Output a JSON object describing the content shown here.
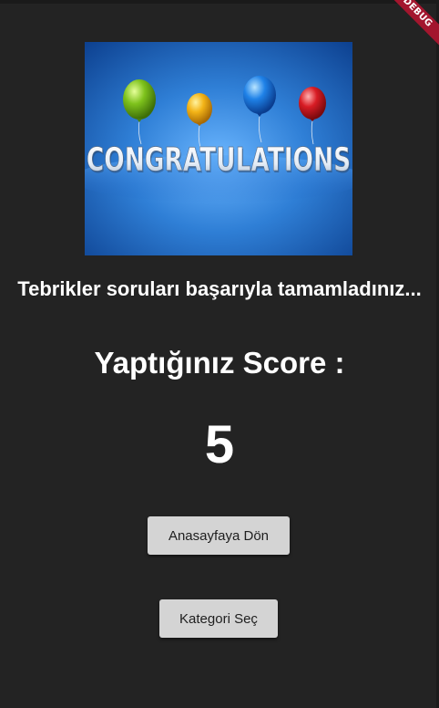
{
  "debug_banner": {
    "label": "DEBUG"
  },
  "hero_image": {
    "banner_text": "CONGRATULATIONS"
  },
  "result": {
    "message": "Tebrikler soruları başarıyla tamamladınız...",
    "score_label": "Yaptığınız Score :",
    "score_value": "5"
  },
  "buttons": {
    "home_label": "Anasayfaya Dön",
    "category_label": "Kategori Seç"
  },
  "colors": {
    "background": "#232323",
    "button": "#d4d4d4",
    "debug_ribbon": "#a3162e"
  }
}
